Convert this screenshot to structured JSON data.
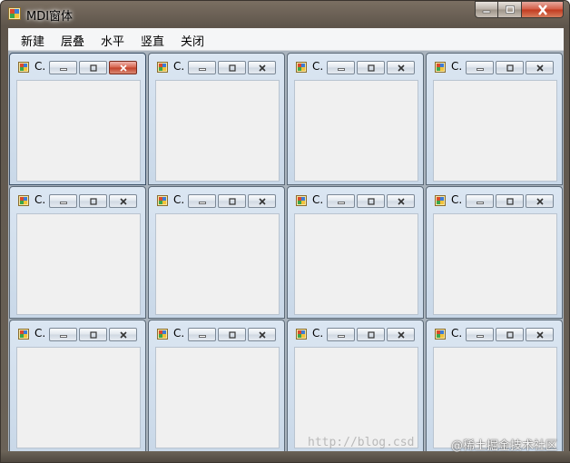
{
  "window": {
    "title": "MDI窗体",
    "caption_buttons": [
      "minimize",
      "maximize",
      "close"
    ]
  },
  "menu": {
    "items": [
      "新建",
      "层叠",
      "水平",
      "竖直",
      "关闭"
    ]
  },
  "children": [
    {
      "title": "C.",
      "active": true
    },
    {
      "title": "C.",
      "active": false
    },
    {
      "title": "C.",
      "active": false
    },
    {
      "title": "C.",
      "active": false
    },
    {
      "title": "C.",
      "active": false
    },
    {
      "title": "C.",
      "active": false
    },
    {
      "title": "C.",
      "active": false
    },
    {
      "title": "C.",
      "active": false
    },
    {
      "title": "C.",
      "active": false
    },
    {
      "title": "C.",
      "active": false
    },
    {
      "title": "C.",
      "active": false
    },
    {
      "title": "C.",
      "active": false
    }
  ],
  "watermark": {
    "url_text": "http://blog.csd",
    "credit_text": "@稀土掘金技术社区"
  },
  "colors": {
    "title_frame": "#6b6358",
    "mdi_background": "#a9b3bd",
    "child_frame": "#c9d8e8",
    "child_client": "#f0f0f0",
    "close_red": "#c2402a"
  }
}
